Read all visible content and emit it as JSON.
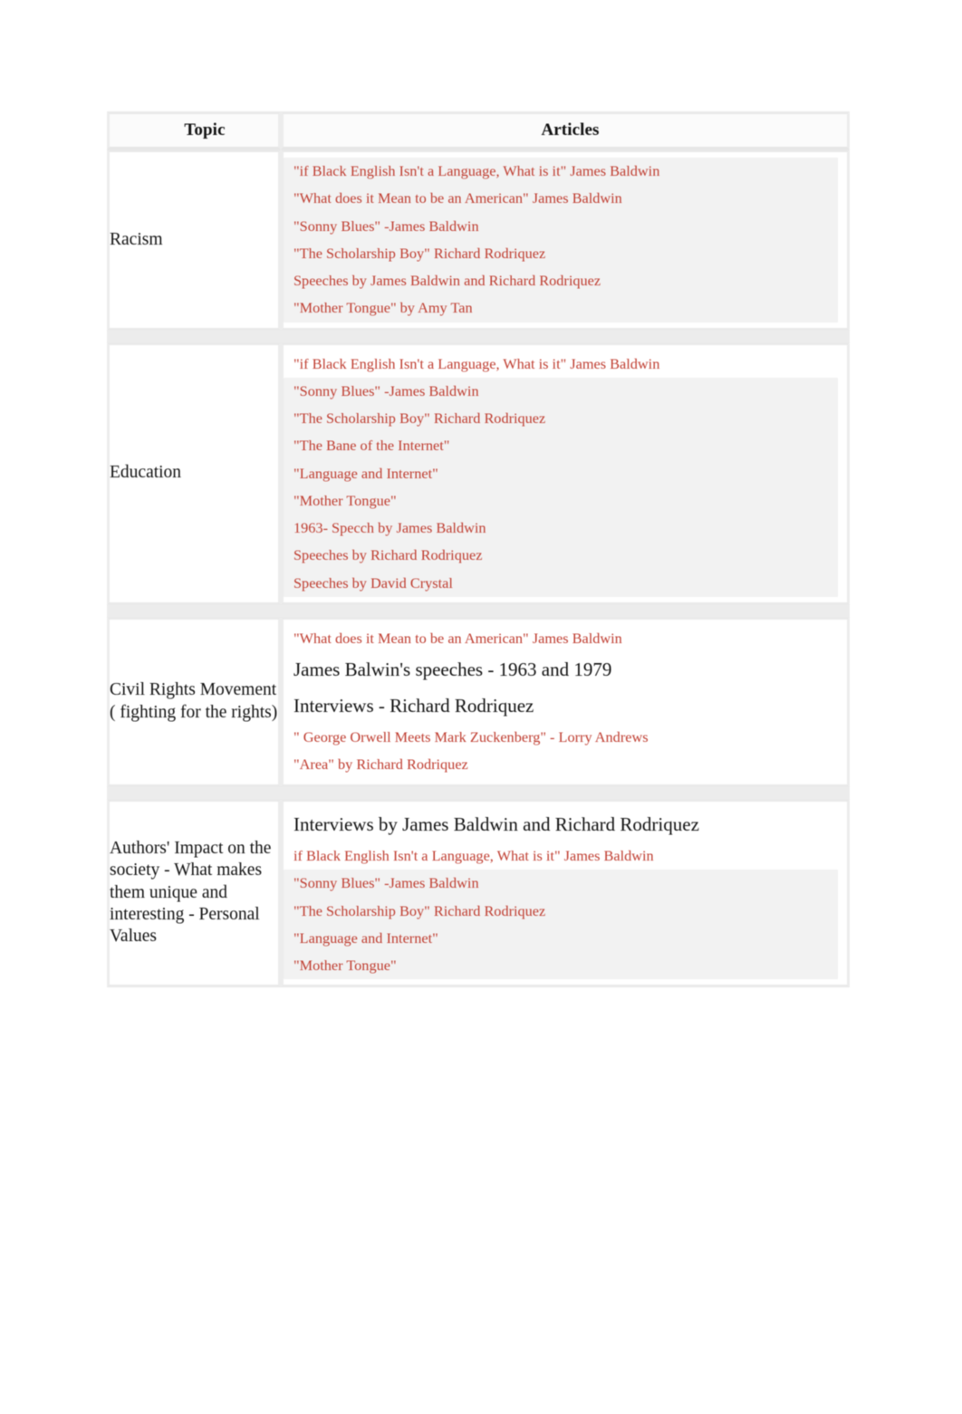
{
  "table": {
    "headers": {
      "topic": "Topic",
      "articles": "Articles"
    },
    "rows": [
      {
        "topic": "Racism",
        "articles": [
          {
            "text": "\"if Black English Isn't a Language, What is it\" James Baldwin",
            "style": "red",
            "shade": "gray"
          },
          {
            "text": "\"What does it Mean to be an American\" James Baldwin",
            "style": "red",
            "shade": "gray"
          },
          {
            "text": "\"Sonny Blues\" -James Baldwin",
            "style": "red",
            "shade": "gray"
          },
          {
            "text": "\"The Scholarship Boy\" Richard Rodriquez",
            "style": "red",
            "shade": "gray"
          },
          {
            "text": "Speeches by James Baldwin and Richard Rodriquez",
            "style": "red",
            "shade": "gray"
          },
          {
            "text": "\"Mother Tongue\" by Amy Tan",
            "style": "red",
            "shade": "gray"
          }
        ]
      },
      {
        "topic": "Education",
        "articles": [
          {
            "text": "\"if Black English Isn't a Language, What is it\" James Baldwin",
            "style": "red",
            "shade": "white"
          },
          {
            "text": "\"Sonny Blues\" -James Baldwin",
            "style": "red",
            "shade": "gray"
          },
          {
            "text": "\"The Scholarship Boy\" Richard Rodriquez",
            "style": "red",
            "shade": "gray"
          },
          {
            "text": "\"The Bane of the Internet\"",
            "style": "red",
            "shade": "gray"
          },
          {
            "text": "\"Language and Internet\"",
            "style": "red",
            "shade": "gray"
          },
          {
            "text": "\"Mother Tongue\"",
            "style": "red",
            "shade": "gray"
          },
          {
            "text": "1963- Specch by James Baldwin",
            "style": "red",
            "shade": "gray"
          },
          {
            "text": "Speeches by Richard Rodriquez",
            "style": "red",
            "shade": "gray"
          },
          {
            "text": "Speeches by David Crystal",
            "style": "red",
            "shade": "gray"
          }
        ]
      },
      {
        "topic": "Civil Rights Movement\n( fighting for the rights)",
        "articles": [
          {
            "text": "\"What does it Mean to be an American\" James Baldwin",
            "style": "red",
            "shade": "white"
          },
          {
            "text": "James Balwin's speeches - 1963 and 1979",
            "style": "black-large",
            "shade": "white"
          },
          {
            "text": "Interviews - Richard Rodriquez",
            "style": "black-large",
            "shade": "white"
          },
          {
            "text": "\" George Orwell Meets Mark Zuckenberg\" - Lorry Andrews",
            "style": "red",
            "shade": "white"
          },
          {
            "text": "\"Area\" by Richard Rodriquez",
            "style": "red",
            "shade": "white"
          }
        ]
      },
      {
        "topic": "Authors' Impact on the society - What makes them unique and interesting - Personal Values",
        "articles": [
          {
            "text": "Interviews by James Baldwin and Richard Rodriquez",
            "style": "black-large",
            "shade": "white"
          },
          {
            "text": "if Black English Isn't a Language, What is it\" James Baldwin",
            "style": "red",
            "shade": "white"
          },
          {
            "text": "\"Sonny Blues\" -James Baldwin",
            "style": "red",
            "shade": "gray"
          },
          {
            "text": "\"The Scholarship Boy\" Richard Rodriquez",
            "style": "red",
            "shade": "gray"
          },
          {
            "text": "\"Language and Internet\"",
            "style": "red",
            "shade": "gray"
          },
          {
            "text": "\"Mother Tongue\"",
            "style": "red",
            "shade": "gray"
          }
        ]
      }
    ]
  },
  "colors": {
    "article_red": "#bf3c2f",
    "text_black": "#111111",
    "cell_shade": "#f2f2f2",
    "border": "#ececec"
  }
}
